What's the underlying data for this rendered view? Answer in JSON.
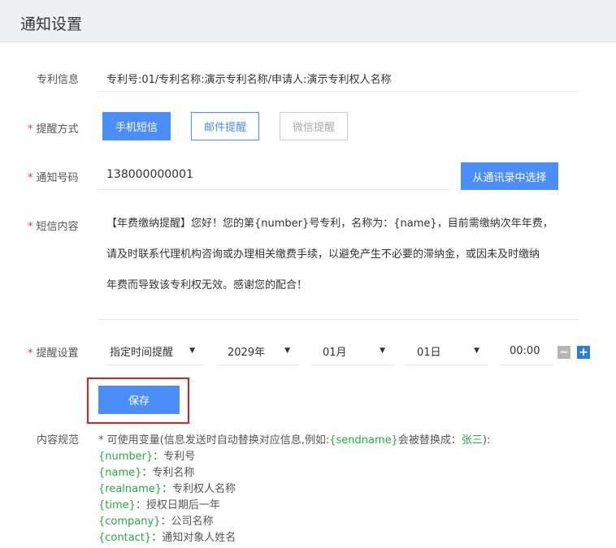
{
  "header": {
    "title": "通知设置"
  },
  "patent": {
    "label": "专利信息",
    "value": "专利号:01/专利名称:演示专利名称/申请人:演示专利权人名称"
  },
  "remind_method": {
    "label": "提醒方式",
    "options": [
      "手机短信",
      "邮件提醒",
      "微信提醒"
    ]
  },
  "notify_number": {
    "label": "通知号码",
    "value": "138000000001",
    "contacts_button": "从通讯录中选择"
  },
  "sms_content": {
    "label": "短信内容",
    "lines": [
      "【年费缴纳提醒】您好！您的第{number}号专利，名称为：{name}，目前需缴纳次年年费，",
      "请及时联系代理机构咨询或办理相关缴费手续，以避免产生不必要的滞纳金，或因未及时缴纳",
      "年费而导致该专利权无效。感谢您的配合！"
    ]
  },
  "remind_setting": {
    "label": "提醒设置",
    "mode": "指定时间提醒",
    "year": "2029年",
    "month": "01月",
    "day": "01日",
    "time": "00:00"
  },
  "save_button": "保存",
  "spec": {
    "label": "内容规范",
    "intro_prefix": "* 可使用变量(信息发送时自动替换对应信息,例如:",
    "intro_var": "{sendname}",
    "intro_mid": "会被替换成：",
    "intro_example": "张三",
    "intro_suffix": "):",
    "items": [
      {
        "var": "{number}",
        "desc": "：专利号"
      },
      {
        "var": "{name}",
        "desc": "：专利名称"
      },
      {
        "var": "{realname}",
        "desc": "：专利权人名称"
      },
      {
        "var": "{time}",
        "desc": "：授权日期后一年"
      },
      {
        "var": "{company}",
        "desc": "：公司名称"
      },
      {
        "var": "{contact}",
        "desc": "：通知对象人姓名"
      }
    ]
  },
  "colors": {
    "primary": "#4c8ef7",
    "required": "#e4393c",
    "variable": "#28a745",
    "highlight_box": "#e02020"
  }
}
